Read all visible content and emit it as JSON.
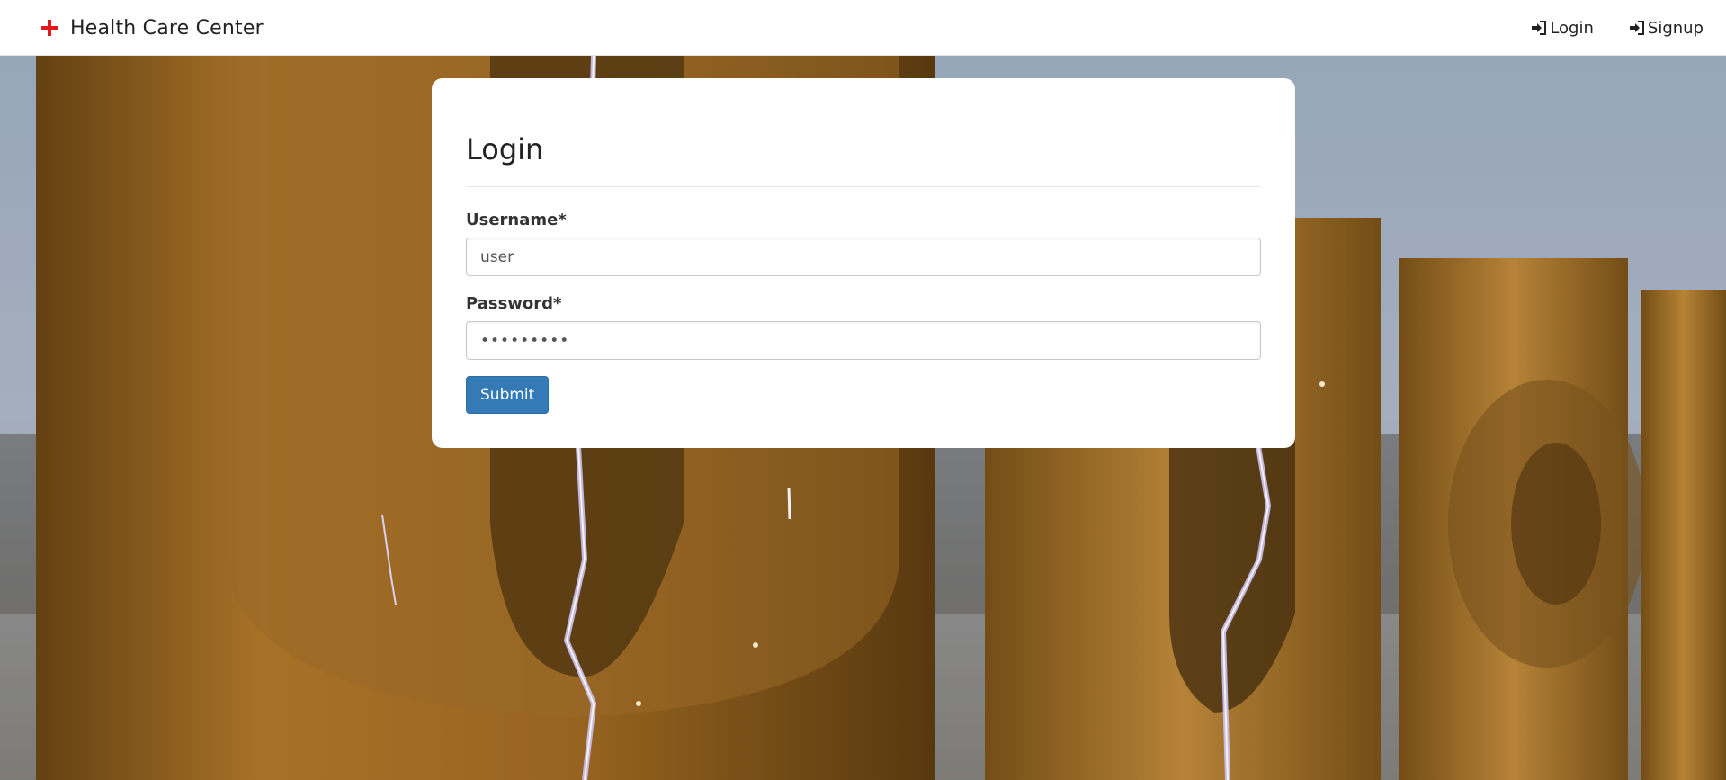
{
  "navbar": {
    "brand_name": "Health Care Center",
    "brand_icon": "red-cross-icon",
    "links": [
      {
        "label": "Login",
        "icon": "sign-in-icon"
      },
      {
        "label": "Signup",
        "icon": "sign-in-icon"
      }
    ]
  },
  "login_form": {
    "title": "Login",
    "username_label": "Username*",
    "username_value": "user",
    "password_label": "Password*",
    "password_value": "•••••••••",
    "submit_label": "Submit"
  },
  "colors": {
    "brand_icon": "#e0191b",
    "primary_button": "#337ab7"
  }
}
